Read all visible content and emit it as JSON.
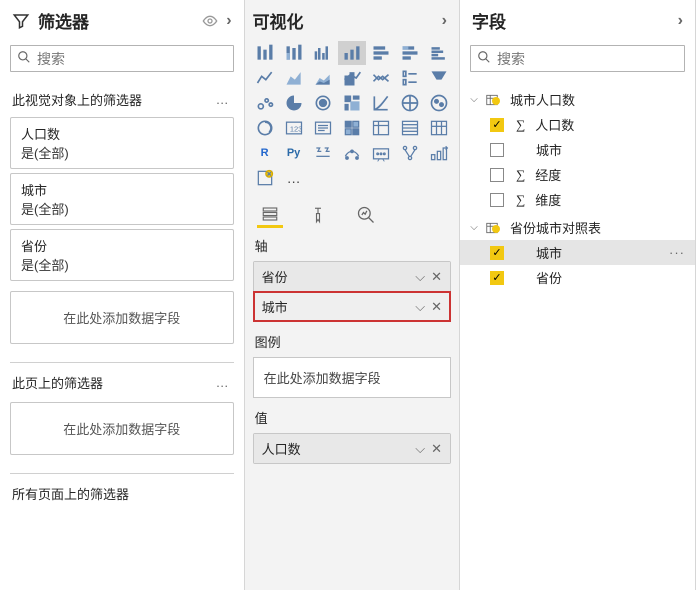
{
  "filter_pane": {
    "title": "筛选器",
    "search_placeholder": "搜索",
    "section_visual": "此视觉对象上的筛选器",
    "cards": [
      {
        "name": "人口数",
        "value": "是(全部)"
      },
      {
        "name": "城市",
        "value": "是(全部)"
      },
      {
        "name": "省份",
        "value": "是(全部)"
      }
    ],
    "placeholder": "在此处添加数据字段",
    "section_page": "此页上的筛选器",
    "section_allpages": "所有页面上的筛选器"
  },
  "viz_pane": {
    "title": "可视化",
    "bucket_axis": "轴",
    "axis_items": [
      {
        "label": "省份",
        "highlight": false
      },
      {
        "label": "城市",
        "highlight": true
      }
    ],
    "bucket_legend": "图例",
    "legend_placeholder": "在此处添加数据字段",
    "bucket_value": "值",
    "value_items": [
      {
        "label": "人口数"
      }
    ]
  },
  "fields_pane": {
    "title": "字段",
    "search_placeholder": "搜索",
    "tables": [
      {
        "name": "城市人口数",
        "used": true,
        "fields": [
          {
            "name": "人口数",
            "checked": true,
            "sigma": true
          },
          {
            "name": "城市",
            "checked": false,
            "sigma": false
          },
          {
            "name": "经度",
            "checked": false,
            "sigma": true
          },
          {
            "name": "维度",
            "checked": false,
            "sigma": true
          }
        ]
      },
      {
        "name": "省份城市对照表",
        "used": true,
        "fields": [
          {
            "name": "城市",
            "checked": true,
            "sigma": false,
            "selected": true
          },
          {
            "name": "省份",
            "checked": true,
            "sigma": false
          }
        ]
      }
    ]
  }
}
